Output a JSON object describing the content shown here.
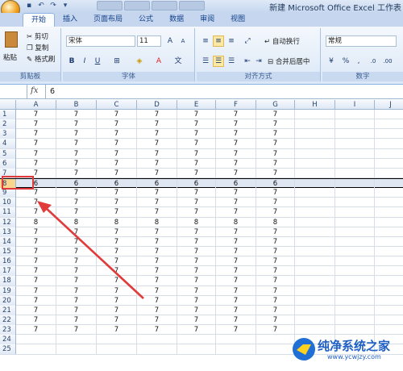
{
  "window": {
    "title": "新建 Microsoft Office Excel 工作表"
  },
  "ribbon": {
    "tabs": [
      "开始",
      "插入",
      "页面布局",
      "公式",
      "数据",
      "审阅",
      "视图"
    ],
    "clipboard": {
      "paste": "粘贴",
      "cut": "剪切",
      "copy": "复制",
      "format_painter": "格式刷",
      "label": "剪贴板"
    },
    "font": {
      "name": "宋体",
      "size": "11",
      "label": "字体",
      "bold": "B",
      "italic": "I",
      "underline": "U"
    },
    "alignment": {
      "wrap": "自动换行",
      "merge": "合并后居中",
      "label": "对齐方式"
    },
    "number": {
      "format": "常规",
      "label": "数字",
      "percent": "%",
      "comma": ",",
      "inc": ".0",
      "dec": ".00"
    }
  },
  "formula_bar": {
    "fx": "fx",
    "value": "6"
  },
  "columns": [
    "A",
    "B",
    "C",
    "D",
    "E",
    "F",
    "G",
    "H",
    "I",
    "J"
  ],
  "rows": [
    {
      "n": "1",
      "v": [
        "7",
        "7",
        "7",
        "7",
        "7",
        "7",
        "7"
      ]
    },
    {
      "n": "2",
      "v": [
        "7",
        "7",
        "7",
        "7",
        "7",
        "7",
        "7"
      ]
    },
    {
      "n": "3",
      "v": [
        "7",
        "7",
        "7",
        "7",
        "7",
        "7",
        "7"
      ]
    },
    {
      "n": "4",
      "v": [
        "7",
        "7",
        "7",
        "7",
        "7",
        "7",
        "7"
      ]
    },
    {
      "n": "5",
      "v": [
        "7",
        "7",
        "7",
        "7",
        "7",
        "7",
        "7"
      ]
    },
    {
      "n": "6",
      "v": [
        "7",
        "7",
        "7",
        "7",
        "7",
        "7",
        "7"
      ]
    },
    {
      "n": "7",
      "v": [
        "7",
        "7",
        "7",
        "7",
        "7",
        "7",
        "7"
      ]
    },
    {
      "n": "8",
      "v": [
        "6",
        "6",
        "6",
        "6",
        "6",
        "6",
        "6"
      ],
      "selected": true
    },
    {
      "n": "9",
      "v": [
        "7",
        "7",
        "7",
        "7",
        "7",
        "7",
        "7"
      ]
    },
    {
      "n": "10",
      "v": [
        "7",
        "7",
        "7",
        "7",
        "7",
        "7",
        "7"
      ]
    },
    {
      "n": "11",
      "v": [
        "7",
        "7",
        "7",
        "7",
        "7",
        "7",
        "7"
      ]
    },
    {
      "n": "12",
      "v": [
        "8",
        "8",
        "8",
        "8",
        "8",
        "8",
        "8"
      ]
    },
    {
      "n": "13",
      "v": [
        "7",
        "7",
        "7",
        "7",
        "7",
        "7",
        "7"
      ]
    },
    {
      "n": "14",
      "v": [
        "7",
        "7",
        "7",
        "7",
        "7",
        "7",
        "7"
      ]
    },
    {
      "n": "15",
      "v": [
        "7",
        "7",
        "7",
        "7",
        "7",
        "7",
        "7"
      ]
    },
    {
      "n": "16",
      "v": [
        "7",
        "7",
        "7",
        "7",
        "7",
        "7",
        "7"
      ]
    },
    {
      "n": "17",
      "v": [
        "7",
        "7",
        "7",
        "7",
        "7",
        "7",
        "7"
      ]
    },
    {
      "n": "18",
      "v": [
        "7",
        "7",
        "7",
        "7",
        "7",
        "7",
        "7"
      ]
    },
    {
      "n": "19",
      "v": [
        "7",
        "7",
        "7",
        "7",
        "7",
        "7",
        "7"
      ]
    },
    {
      "n": "20",
      "v": [
        "7",
        "7",
        "7",
        "7",
        "7",
        "7",
        "7"
      ]
    },
    {
      "n": "21",
      "v": [
        "7",
        "7",
        "7",
        "7",
        "7",
        "7",
        "7"
      ]
    },
    {
      "n": "22",
      "v": [
        "7",
        "7",
        "7",
        "7",
        "7",
        "7",
        "7"
      ]
    },
    {
      "n": "23",
      "v": [
        "7",
        "7",
        "7",
        "7",
        "7",
        "7",
        "7"
      ]
    },
    {
      "n": "24",
      "v": [
        "",
        "",
        "",
        "",
        "",
        "",
        ""
      ]
    },
    {
      "n": "25",
      "v": [
        "",
        "",
        "",
        "",
        "",
        "",
        ""
      ]
    }
  ],
  "watermark": {
    "text": "纯净系统之家",
    "url": "www.ycwjzy.com"
  },
  "colors": {
    "annotation": "#e03a3a",
    "accent": "#15428b"
  }
}
